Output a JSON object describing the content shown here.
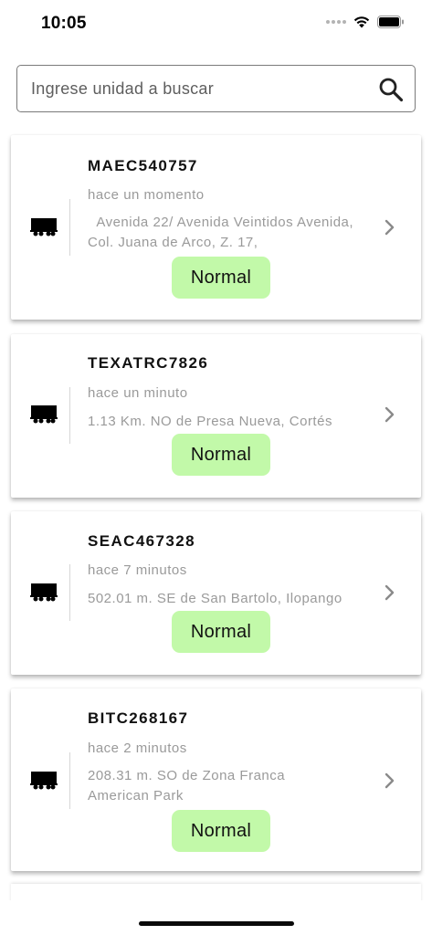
{
  "status_bar": {
    "time": "10:05"
  },
  "search": {
    "placeholder": "Ingrese unidad a buscar",
    "value": ""
  },
  "units": [
    {
      "id": "MAEC540757",
      "time_ago": "hace un momento",
      "address": "  Avenida 22/ Avenida Veintidos Avenida, Col. Juana de Arco, Z. 17,",
      "status": "Normal"
    },
    {
      "id": "TEXATRC7826",
      "time_ago": "hace un minuto",
      "address": "1.13 Km. NO de Presa Nueva, Cortés",
      "status": "Normal"
    },
    {
      "id": "SEAC467328",
      "time_ago": "hace 7 minutos",
      "address": "502.01 m. SE de San Bartolo, Ilopango",
      "status": "Normal"
    },
    {
      "id": "BITC268167",
      "time_ago": "hace 2 minutos",
      "address": "208.31 m. SO de Zona Franca American Park",
      "status": "Normal"
    }
  ],
  "colors": {
    "status_normal_bg": "#c2f9a9",
    "secondary_text": "#9a9a9a"
  },
  "icons": {
    "search": "search-icon",
    "truck": "truck-icon",
    "chevron": "chevron-right-icon"
  }
}
